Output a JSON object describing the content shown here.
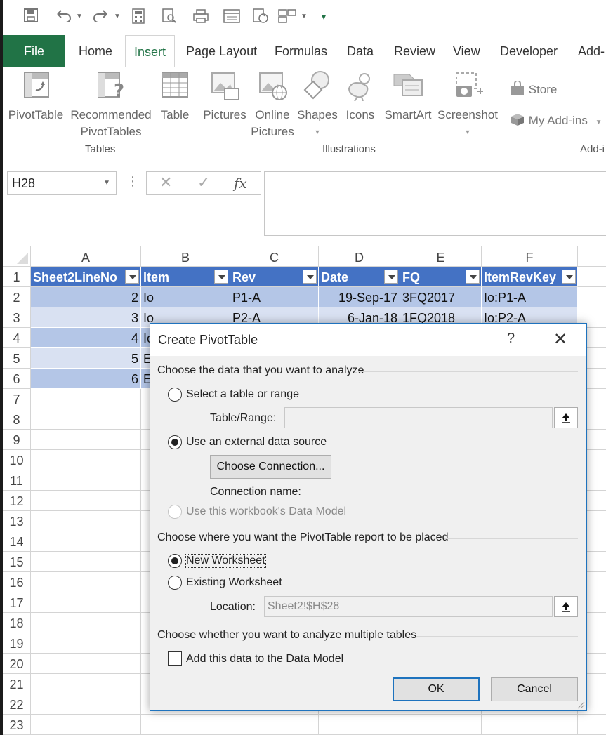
{
  "ribbon_tabs": [
    "File",
    "Home",
    "Insert",
    "Page Layout",
    "Formulas",
    "Data",
    "Review",
    "View",
    "Developer",
    "Add-"
  ],
  "ribbon": {
    "tables": {
      "pivottable": "PivotTable",
      "recommended_line1": "Recommended",
      "recommended_line2": "PivotTables",
      "table": "Table",
      "group": "Tables"
    },
    "illustrations": {
      "pictures": "Pictures",
      "online_line1": "Online",
      "online_line2": "Pictures",
      "shapes": "Shapes",
      "icons": "Icons",
      "smartart": "SmartArt",
      "screenshot": "Screenshot",
      "group": "Illustrations"
    },
    "addins": {
      "store": "Store",
      "myaddins": "My Add-ins",
      "group": "Add-i"
    }
  },
  "formula_bar": {
    "name_box": "H28",
    "fx": "fx",
    "formula": ""
  },
  "sheet": {
    "columns": [
      "A",
      "B",
      "C",
      "D",
      "E",
      "F"
    ],
    "rows": [
      "1",
      "2",
      "3",
      "4",
      "5",
      "6",
      "7",
      "8",
      "9",
      "10",
      "11",
      "12",
      "13",
      "14",
      "15",
      "16",
      "17",
      "18",
      "19",
      "20",
      "21",
      "22",
      "23"
    ],
    "headers": [
      "Sheet2LineNo",
      "Item",
      "Rev",
      "Date",
      "FQ",
      "ItemRevKey"
    ],
    "data": [
      [
        "2",
        "Io",
        "P1-A",
        "19-Sep-17",
        "3FQ2017",
        "Io:P1-A"
      ],
      [
        "3",
        "Io",
        "P2-A",
        "6-Jan-18",
        "1FQ2018",
        "Io:P2-A"
      ],
      [
        "4",
        "Io",
        "",
        "",
        "",
        ""
      ],
      [
        "5",
        "E",
        "",
        "",
        "",
        ""
      ],
      [
        "6",
        "E",
        "",
        "",
        "",
        ""
      ]
    ]
  },
  "dialog": {
    "title": "Create PivotTable",
    "help": "?",
    "section1": "Choose the data that you want to analyze",
    "opt_table_range": "Select a table or range",
    "table_range_label": "Table/Range:",
    "table_range_value": "",
    "opt_external": "Use an external data source",
    "choose_connection": "Choose Connection...",
    "connection_name_label": "Connection name:",
    "opt_data_model": "Use this workbook's Data Model",
    "section2": "Choose where you want the PivotTable report to be placed",
    "opt_new_ws": "New Worksheet",
    "opt_existing_ws": "Existing Worksheet",
    "location_label": "Location:",
    "location_value": "Sheet2!$H$28",
    "section3": "Choose whether you want to analyze multiple tables",
    "add_data_model": "Add this data to the Data Model",
    "ok": "OK",
    "cancel": "Cancel"
  },
  "colors": {
    "excel_green": "#217346",
    "table_header": "#4472c4",
    "band_dark": "#b4c6e7",
    "band_light": "#d9e1f2",
    "dialog_border": "#1e73be"
  },
  "icons": [
    "save-icon",
    "undo-icon",
    "redo-icon",
    "calculator-icon",
    "print-preview-icon",
    "print-icon",
    "form-icon",
    "refresh-icon",
    "layout-icon",
    "customize-qat-icon"
  ]
}
